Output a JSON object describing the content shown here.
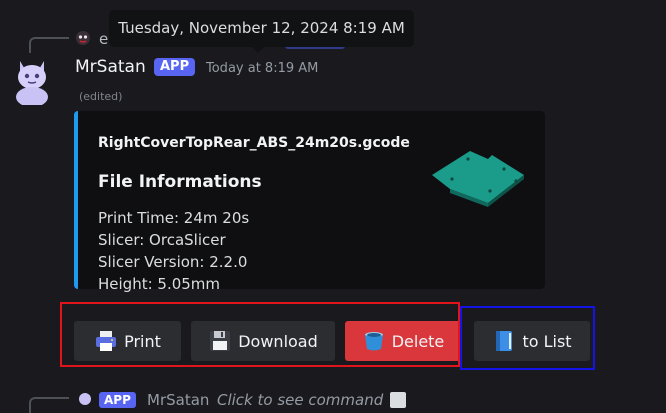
{
  "tooltip": {
    "text": "Tuesday, November 12, 2024 8:19 AM"
  },
  "reply": {
    "name_fragment": "e"
  },
  "message": {
    "username": "MrSatan",
    "badge": "APP",
    "timestamp": "Today at 8:19 AM",
    "edited": "(edited)"
  },
  "embed": {
    "accent_color": "#1e9bf0",
    "title": "RightCoverTopRear_ABS_24m20s.gcode",
    "field_name": "File Informations",
    "lines": [
      "Print Time: 24m 20s",
      "Slicer: OrcaSlicer",
      "Slicer Version: 2.2.0",
      "Height: 5.05mm"
    ],
    "thumbnail_icon": "model-thumbnail"
  },
  "buttons": [
    {
      "label": "Print",
      "icon": "printer-icon"
    },
    {
      "label": "Download",
      "icon": "floppy-disk-icon"
    },
    {
      "label": "Delete",
      "icon": "trash-bucket-icon",
      "color": "#da373c"
    },
    {
      "label": "to List",
      "icon": "book-icon"
    }
  ],
  "next_message": {
    "badge": "APP",
    "username": "MrSatan",
    "command": "Click to see command"
  },
  "colors": {
    "highlight_red": "#e0141b",
    "highlight_blue": "#1414e6",
    "brand": "#5865f2"
  }
}
